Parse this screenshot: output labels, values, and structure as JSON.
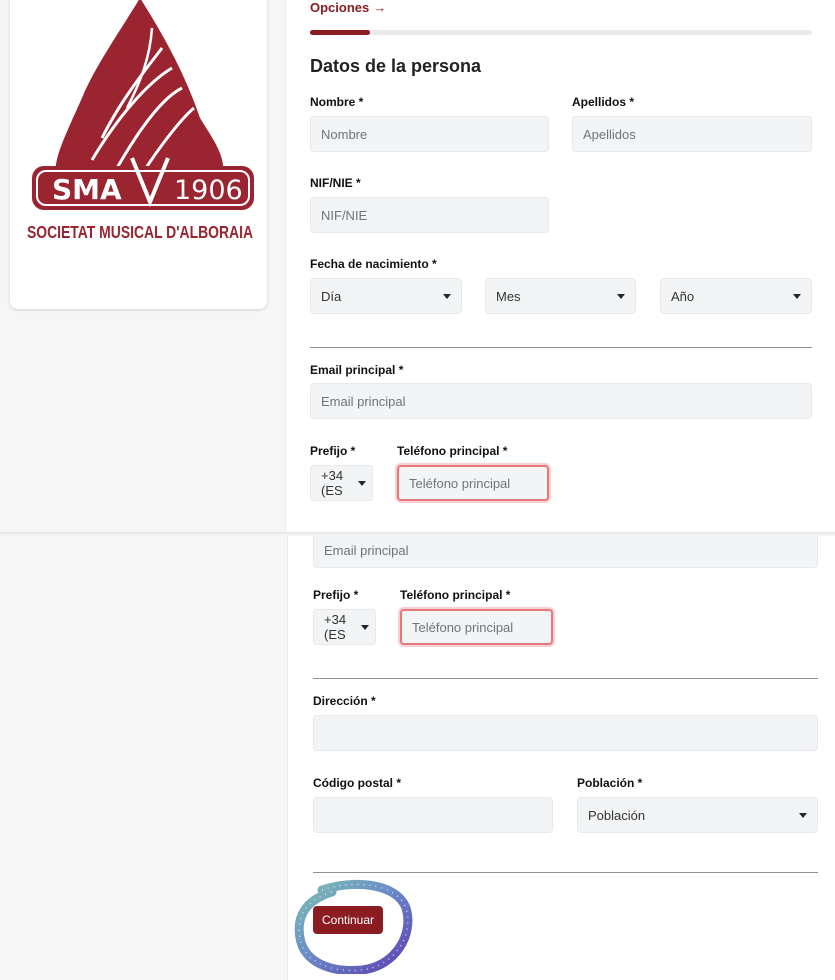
{
  "colors": {
    "brand": "#8a1c22",
    "focus_border": "#e5787b"
  },
  "logo": {
    "letters": "SMA",
    "year": "1906",
    "name": "SOCIETAT MUSICAL D'ALBORAIA"
  },
  "stepper": {
    "label": "Opciones",
    "arrow": "→",
    "progress_fraction": 0.12
  },
  "form": {
    "title": "Datos de la persona",
    "nombre": {
      "label": "Nombre *",
      "placeholder": "Nombre"
    },
    "apellidos": {
      "label": "Apellidos *",
      "placeholder": "Apellidos"
    },
    "nif": {
      "label": "NIF/NIE *",
      "placeholder": "NIF/NIE"
    },
    "fecha": {
      "label": "Fecha de nacimiento *",
      "dia": "Día",
      "mes": "Mes",
      "anio": "Año"
    },
    "email": {
      "label": "Email principal *",
      "placeholder": "Email principal"
    },
    "prefijo": {
      "label": "Prefijo *",
      "value": "+34 (ES"
    },
    "telefono": {
      "label": "Teléfono principal *",
      "placeholder": "Teléfono principal"
    },
    "direccion": {
      "label": "Dirección *",
      "placeholder": ""
    },
    "codigo_postal": {
      "label": "Código postal *",
      "placeholder": ""
    },
    "poblacion": {
      "label": "Población *",
      "value": "Población"
    },
    "continuar_label": "Continuar"
  }
}
